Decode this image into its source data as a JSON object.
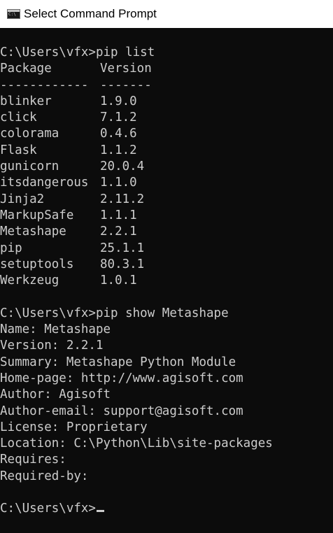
{
  "window": {
    "title": "Select Command Prompt",
    "icon": "cmd-icon"
  },
  "console": {
    "prompt1": "C:\\Users\\vfx>pip list",
    "list_header": {
      "package": "Package",
      "version": "Version"
    },
    "list_separator": {
      "package": "------------",
      "version": "-------"
    },
    "packages": [
      {
        "name": "blinker",
        "version": "1.9.0"
      },
      {
        "name": "click",
        "version": "7.1.2"
      },
      {
        "name": "colorama",
        "version": "0.4.6"
      },
      {
        "name": "Flask",
        "version": "1.1.2"
      },
      {
        "name": "gunicorn",
        "version": "20.0.4"
      },
      {
        "name": "itsdangerous",
        "version": "1.1.0"
      },
      {
        "name": "Jinja2",
        "version": "2.11.2"
      },
      {
        "name": "MarkupSafe",
        "version": "1.1.1"
      },
      {
        "name": "Metashape",
        "version": "2.2.1"
      },
      {
        "name": "pip",
        "version": "25.1.1"
      },
      {
        "name": "setuptools",
        "version": "80.3.1"
      },
      {
        "name": "Werkzeug",
        "version": "1.0.1"
      }
    ],
    "prompt2": "C:\\Users\\vfx>pip show Metashape",
    "show_output": [
      "Name: Metashape",
      "Version: 2.2.1",
      "Summary: Metashape Python Module",
      "Home-page: http://www.agisoft.com",
      "Author: Agisoft",
      "Author-email: support@agisoft.com",
      "License: Proprietary",
      "Location: C:\\Python\\Lib\\site-packages",
      "Requires:",
      "Required-by:"
    ],
    "prompt3": "C:\\Users\\vfx>"
  }
}
